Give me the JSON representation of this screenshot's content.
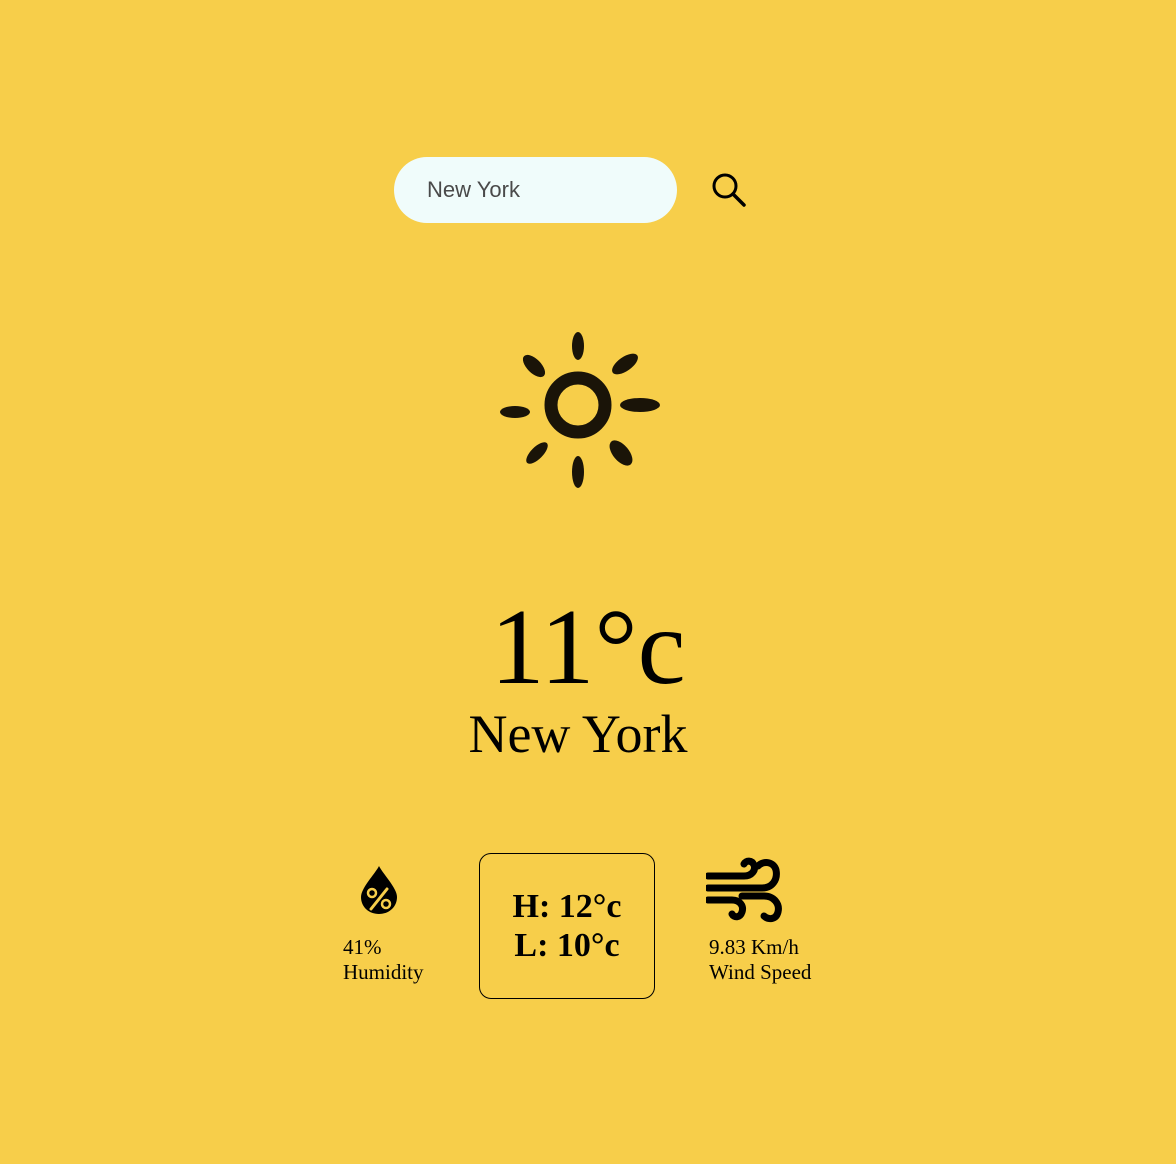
{
  "search": {
    "value": "New York",
    "placeholder": ""
  },
  "icons": {
    "search": "search-icon",
    "weather": "sun-icon",
    "humidity": "humidity-drop-icon",
    "wind": "wind-icon"
  },
  "current": {
    "temperature": "11°c",
    "city": "New York"
  },
  "details": {
    "humidity_value": "41%",
    "humidity_label": "Humidity",
    "high": "H: 12°c",
    "low": "L: 10°c",
    "wind_value": "9.83 Km/h",
    "wind_label": "Wind Speed"
  },
  "colors": {
    "background": "#F7CE4A",
    "search_field": "#F0FCFB",
    "text": "#000000"
  }
}
